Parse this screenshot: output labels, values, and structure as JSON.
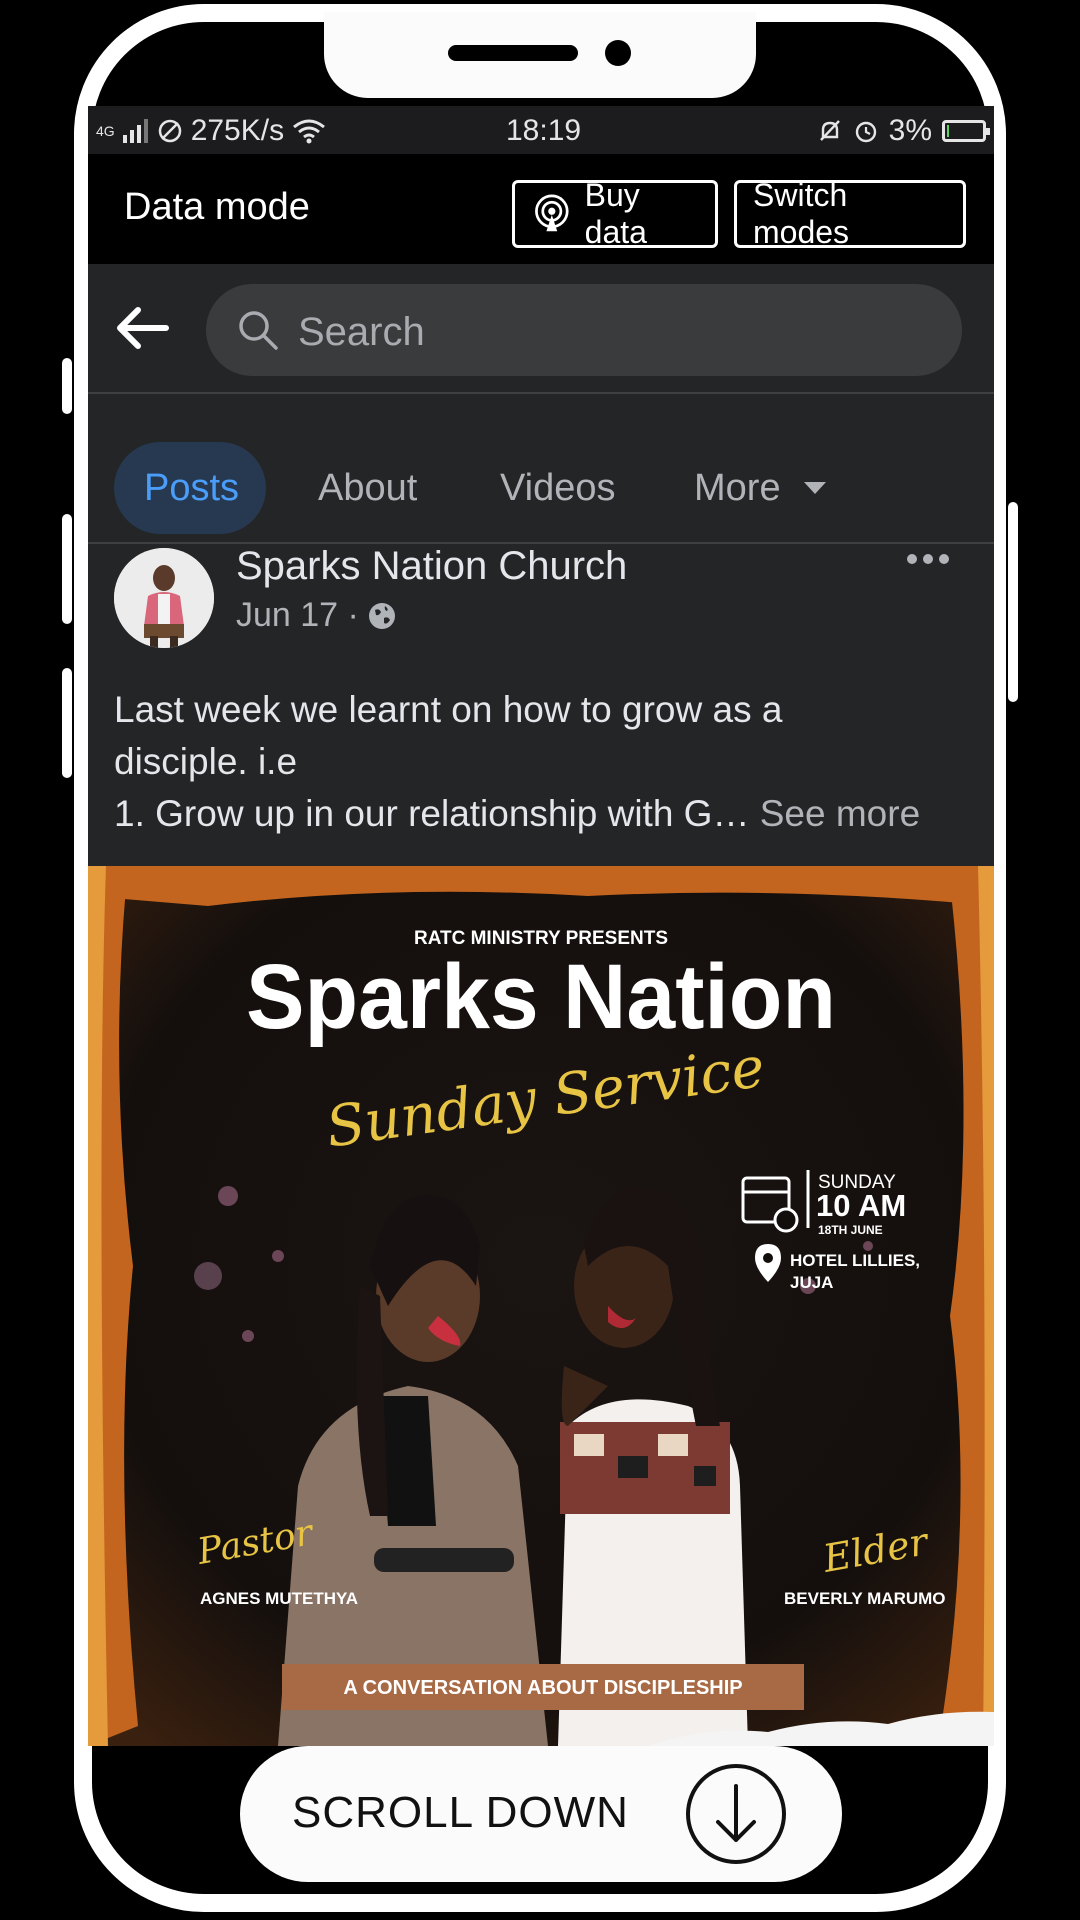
{
  "status_bar": {
    "network": "4G",
    "speed": "275K/s",
    "time": "18:19",
    "battery": "3%",
    "battery_level": 0.03
  },
  "data_mode": {
    "title": "Data mode",
    "buy_data_label": "Buy data",
    "switch_modes_label": "Switch modes"
  },
  "search": {
    "placeholder": "Search"
  },
  "tabs": [
    {
      "label": "Posts",
      "active": true
    },
    {
      "label": "About",
      "active": false
    },
    {
      "label": "Videos",
      "active": false
    },
    {
      "label": "More",
      "active": false
    }
  ],
  "post": {
    "page_name": "Sparks Nation Church",
    "date": "Jun 17 ·",
    "text_line1": "Last week we learnt on how to grow as a",
    "text_line2": "disciple. i.e",
    "text_line3": "1. Grow up in our relationship with G…",
    "see_more": "See more"
  },
  "poster": {
    "presenter": "RATC MINISTRY PRESENTS",
    "title": "Sparks Nation",
    "subtitle": "Sunday Service",
    "day": "SUNDAY",
    "time": "10 AM",
    "date": "18TH JUNE",
    "venue_line1": "HOTEL LILLIES,",
    "venue_line2": "JUJA",
    "left_role": "Pastor",
    "left_name": "AGNES MUTETHYA",
    "right_role": "Elder",
    "right_name": "BEVERLY MARUMO",
    "banner": "A CONVERSATION ABOUT DISCIPLESHIP",
    "accent_gold": "#e8c445",
    "banner_color": "#a86a45"
  },
  "scroll_button": {
    "label": "SCROLL DOWN"
  }
}
